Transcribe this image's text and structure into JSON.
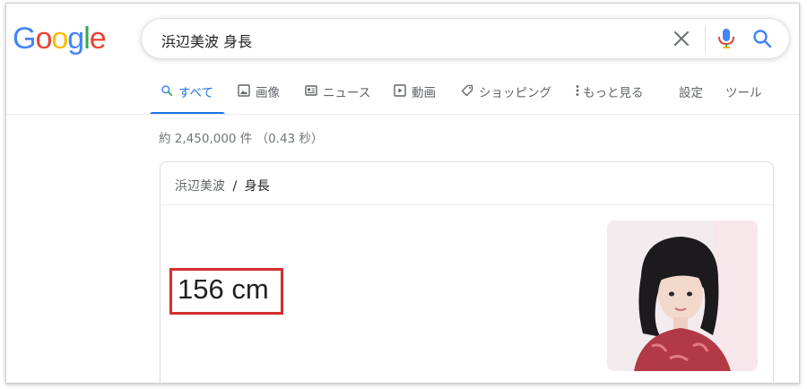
{
  "logo": {
    "letters": [
      "G",
      "o",
      "o",
      "g",
      "l",
      "e"
    ],
    "colors": [
      "#4285f4",
      "#ea4335",
      "#fbbc05",
      "#4285f4",
      "#34a853",
      "#ea4335"
    ]
  },
  "search": {
    "query": "浜辺美波 身長"
  },
  "tabs": [
    {
      "label": "すべて",
      "icon": "search-icon"
    },
    {
      "label": "画像",
      "icon": "image-icon"
    },
    {
      "label": "ニュース",
      "icon": "news-icon"
    },
    {
      "label": "動画",
      "icon": "video-icon"
    },
    {
      "label": "ショッピング",
      "icon": "tag-icon"
    },
    {
      "label": "もっと見る",
      "icon": "more-vert-icon"
    },
    {
      "label": "設定"
    },
    {
      "label": "ツール"
    }
  ],
  "result_stats": "約 2,450,000 件 （0.43 秒）",
  "card": {
    "breadcrumb_parent": "浜辺美波",
    "breadcrumb_sep": "/",
    "breadcrumb_current": "身長",
    "answer": "156 cm",
    "photo": "portrait-photo"
  },
  "colors": {
    "accent": "#1a73e8",
    "highlight_box": "#d32f2f"
  }
}
